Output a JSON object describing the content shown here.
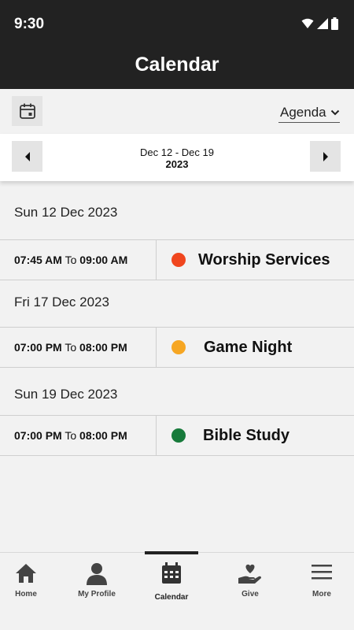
{
  "status_bar": {
    "time": "9:30"
  },
  "header": {
    "title": "Calendar"
  },
  "toolbar": {
    "view_mode": "Agenda"
  },
  "range": {
    "dates": "Dec 12 - Dec 19",
    "year": "2023"
  },
  "days": [
    {
      "date": "Sun 12 Dec 2023",
      "event": {
        "start": "07:45 AM",
        "to": "To",
        "end": "09:00 AM",
        "title": "Worship Services",
        "color": "#f0461e"
      }
    },
    {
      "date": "Fri 17 Dec 2023",
      "event": {
        "start": "07:00 PM",
        "to": "To",
        "end": "08:00 PM",
        "title": "Game Night",
        "color": "#f6a623"
      }
    },
    {
      "date": "Sun 19 Dec 2023",
      "event": {
        "start": "07:00 PM",
        "to": "To",
        "end": "08:00 PM",
        "title": "Bible Study",
        "color": "#177a3b"
      }
    }
  ],
  "tabs": [
    {
      "label": "Home",
      "icon": "home-icon"
    },
    {
      "label": "My Profile",
      "icon": "person-icon"
    },
    {
      "label": "Calendar",
      "icon": "calendar-icon",
      "active": true
    },
    {
      "label": "Give",
      "icon": "give-icon"
    },
    {
      "label": "More",
      "icon": "menu-icon"
    }
  ]
}
